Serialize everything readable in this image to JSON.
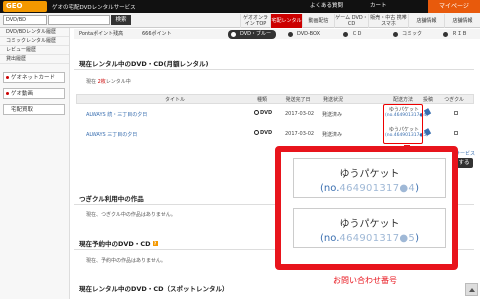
{
  "header": {
    "logo": "GEO Online",
    "tagline": "ゲオの宅配DVDレンタルサービス",
    "faq": "よくある質問",
    "cart": "カート",
    "mypage": "マイページ"
  },
  "search": {
    "select": "DVD/BD",
    "button": "検索",
    "placeholder": ""
  },
  "nav": [
    {
      "label": "ゲオオンライン TOP"
    },
    {
      "label": "宅配レンタル"
    },
    {
      "label": "動画配信"
    },
    {
      "label": "ゲーム DVD・CD"
    },
    {
      "label": "販売・中古 携帯スマホ"
    },
    {
      "label": "店舗情報"
    },
    {
      "label": "店舗情報"
    }
  ],
  "sidebar": {
    "items": [
      "DVD/BDレンタル履歴",
      "コミックレンタル履歴",
      "レビュー履歴",
      "貸出履歴"
    ],
    "buttons": [
      "ゲオネットカード",
      "ゲオ動画",
      "宅配買取"
    ]
  },
  "ponta": {
    "label": "Pontaポイント残高",
    "value": "666ポイント"
  },
  "categories": [
    "DVD・ブルーレイ",
    "DVD-BOX",
    "ＣＤ",
    "コミック",
    "ＲＩＢ"
  ],
  "monthly": {
    "heading": "現在レンタル中のDVD・CD(月額レンタル)",
    "count_prefix": "現在",
    "count": "2枚",
    "count_suffix": "レンタル中",
    "columns": [
      "タイトル",
      "種類",
      "発送完了日",
      "発送状況",
      "配送方法",
      "投稿",
      "つぎクル"
    ],
    "rows": [
      {
        "title": "ALWAYS 続・三丁目の夕日",
        "type": "DVD",
        "date": "2017-03-02",
        "status": "発送済み",
        "method": "ゆうパケット",
        "track": "(no.464901317●4)"
      },
      {
        "title": "ALWAYS 三丁目の夕日",
        "type": "DVD",
        "date": "2017-03-02",
        "status": "発送済み",
        "method": "ゆうパケット",
        "track": "(no.464901317●5)"
      }
    ]
  },
  "next": {
    "heading": "つぎクル利用中の作品",
    "note": "現在、つぎクル中の作品はありません。"
  },
  "reserve": {
    "heading": "現在予約中のDVD・CD",
    "note": "現在、予約中の作品はありません。"
  },
  "spot": {
    "heading": "現在レンタル中のDVD・CD（スポットレンタル）"
  },
  "zoom": {
    "items": [
      {
        "method": "ゆうパケット",
        "track_prefix": "(no.",
        "track_masked": "464901317●4",
        "track_suffix": ")"
      },
      {
        "method": "ゆうパケット",
        "track_prefix": "(no.",
        "track_masked": "464901317●5",
        "track_suffix": ")"
      }
    ],
    "caption": "お問い合わせ番号"
  },
  "right": {
    "link": "サービス",
    "button": "する"
  }
}
